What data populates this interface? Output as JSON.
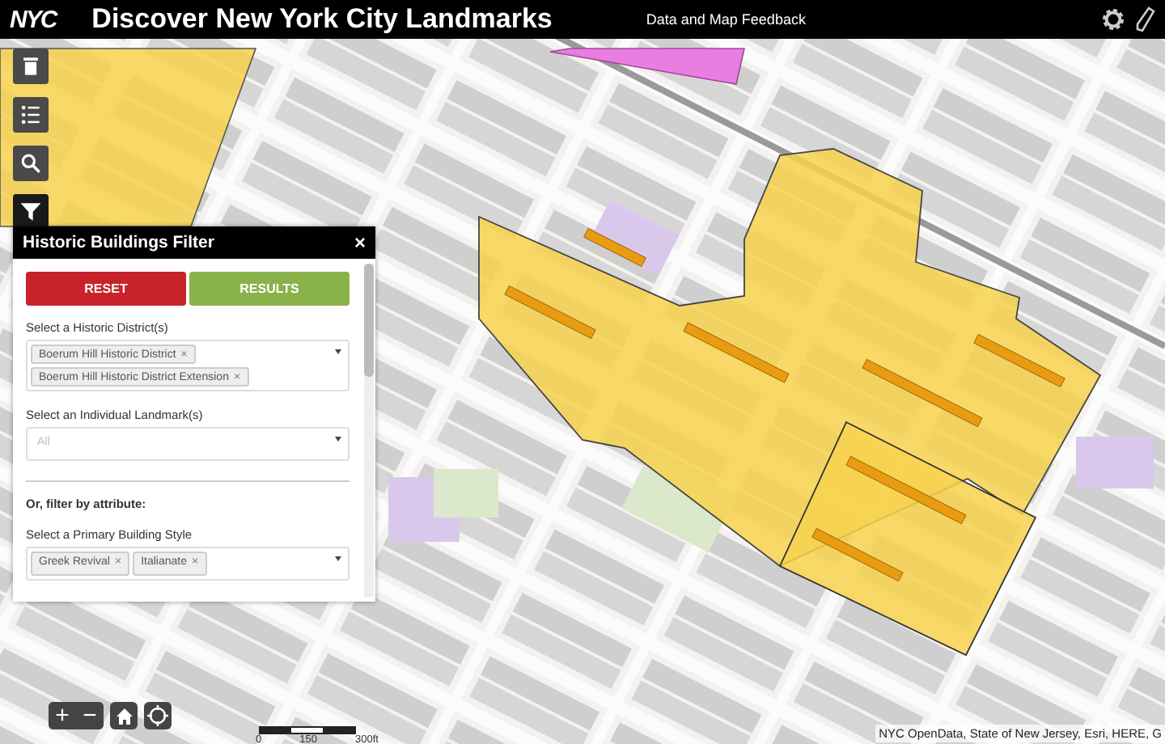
{
  "header": {
    "logo": "NYC",
    "title": "Discover New York City Landmarks",
    "link": "Data and Map Feedback"
  },
  "toolbar": [
    {
      "kind": "column",
      "selected": false
    },
    {
      "kind": "list",
      "selected": false
    },
    {
      "kind": "search",
      "selected": false
    },
    {
      "kind": "filter",
      "selected": true
    }
  ],
  "filter_panel": {
    "title": "Historic Buildings Filter",
    "close": "×",
    "buttons": [
      {
        "kind": "reset",
        "label": "RESET"
      },
      {
        "kind": "results",
        "label": "RESULTS"
      }
    ],
    "sections": [
      {
        "kind": "select",
        "label": "Select a Historic District(s)",
        "tags": [
          {
            "label": "Boerum Hill Historic District",
            "remove": "×"
          },
          {
            "label": "Boerum Hill Historic District Extension",
            "remove": "×"
          }
        ]
      },
      {
        "kind": "select",
        "label": "Select an Individual Landmark(s)",
        "placeholder": "All"
      },
      {
        "kind": "divider"
      },
      {
        "kind": "heading",
        "label": "Or, filter by attribute:"
      },
      {
        "kind": "select",
        "label": "Select a Primary Building Style",
        "tags": [
          {
            "label": "Greek Revival",
            "remove": "×"
          },
          {
            "label": "Italianate",
            "remove": "×"
          }
        ]
      }
    ]
  },
  "map_controls": [
    {
      "kind": "text",
      "label": "+"
    },
    {
      "kind": "text",
      "label": "−"
    },
    {
      "kind": "home"
    },
    {
      "kind": "locate"
    }
  ],
  "scale_bar": {
    "labels": [
      "0",
      "150",
      "300ft"
    ]
  },
  "attribution": "NYC OpenData, State of New Jersey, Esri, HERE, G"
}
